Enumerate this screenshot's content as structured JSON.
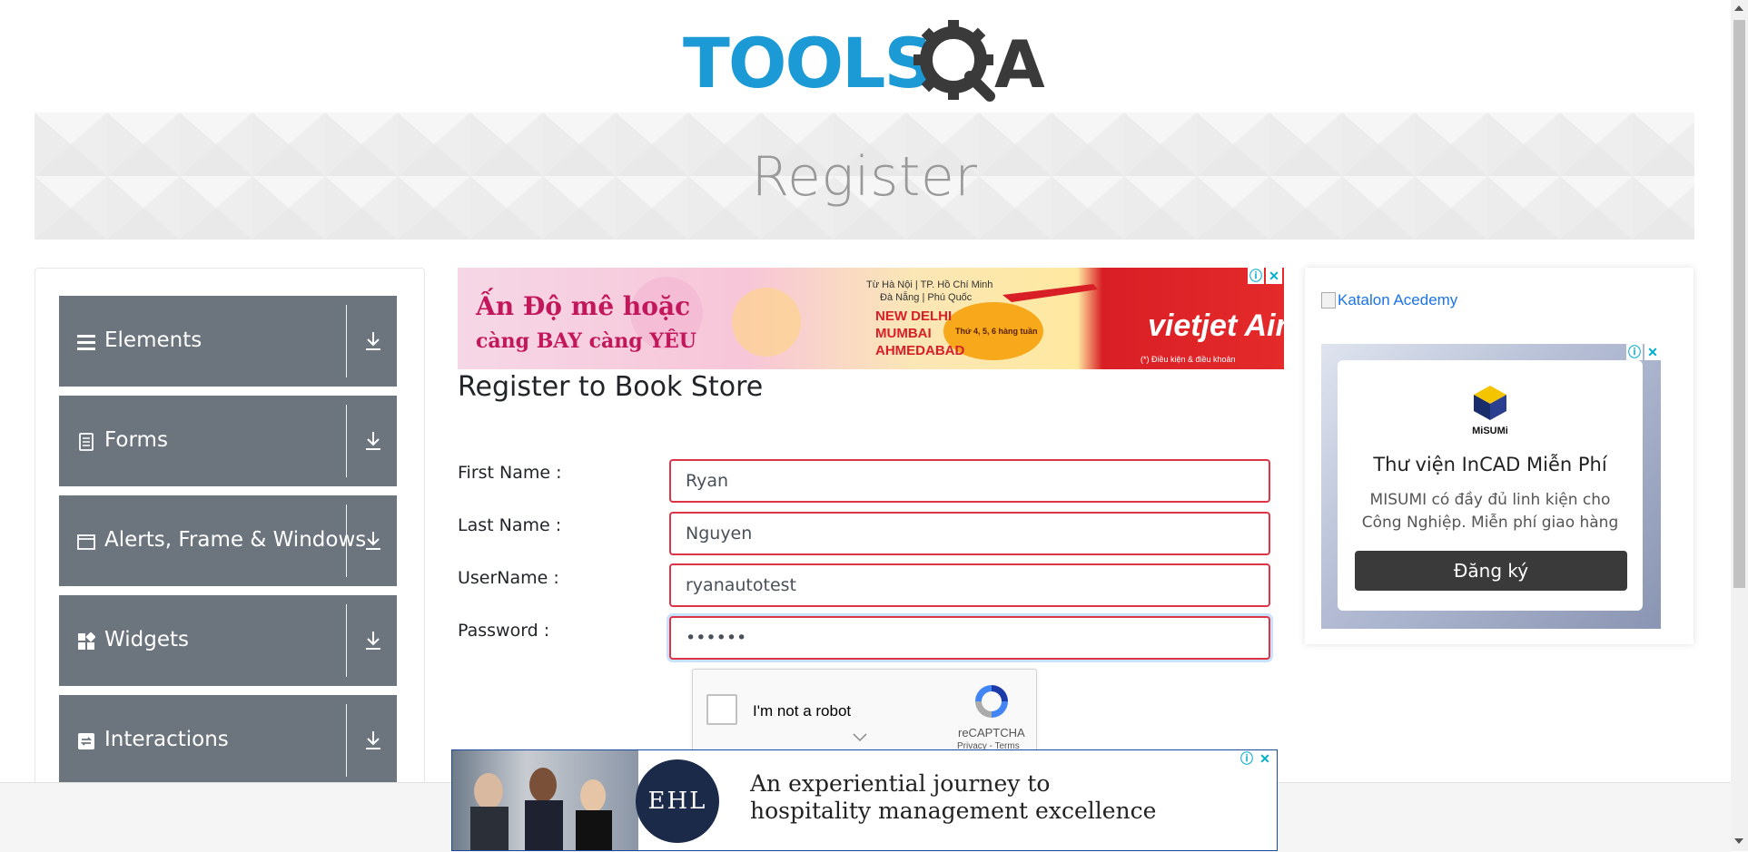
{
  "header": {
    "logo_text": "TOOLSQA"
  },
  "banner": {
    "title": "Register"
  },
  "sidebar": {
    "groups": [
      {
        "label": "Elements",
        "icon": "hamburger-icon"
      },
      {
        "label": "Forms",
        "icon": "document-icon"
      },
      {
        "label": "Alerts, Frame & Windows",
        "icon": "window-icon"
      },
      {
        "label": "Widgets",
        "icon": "widgets-icon"
      },
      {
        "label": "Interactions",
        "icon": "interactions-icon"
      }
    ]
  },
  "ad_top": {
    "headline_1": "Ấn Độ mê hoặc",
    "headline_2": "càng BAY càng YÊU",
    "routes_from": "Từ Hà Nội | TP. Hồ Chí Minh",
    "routes_from_2": "Đà Nẵng | Phú Quốc",
    "destinations": [
      "NEW DELHI",
      "MUMBAI",
      "AHMEDABAD"
    ],
    "days": "Thứ 4, 5, 6 hàng tuần",
    "brand": "vietjet Air.com",
    "disclaimer": "(*) Điều kiện & điều khoản"
  },
  "form": {
    "title": "Register to Book Store",
    "fields": [
      {
        "label": "First Name :",
        "value": "Ryan"
      },
      {
        "label": "Last Name :",
        "value": "Nguyen"
      },
      {
        "label": "UserName :",
        "value": "ryanautotest"
      },
      {
        "label": "Password :",
        "value": "••••••"
      }
    ]
  },
  "captcha": {
    "label": "I'm not a robot",
    "brand": "reCAPTCHA",
    "links": "Privacy - Terms"
  },
  "right_panel": {
    "katalon_alt": "Katalon Acedemy",
    "ad": {
      "logo_name": "MiSUMi",
      "heading": "Thư viện InCAD Miễn Phí",
      "body": "MISUMI có đầy đủ linh kiện cho Công Nghiệp. Miễn phí giao hàng",
      "button": "Đăng ký"
    }
  },
  "ad_bottom": {
    "logo": "EHL",
    "line1": "An experiential journey to",
    "line2": "hospitality management excellence"
  },
  "colors": {
    "sidebar_group_bg": "#6c757d",
    "input_error_border": "#dc3545",
    "logo_blue": "#1b9ad6",
    "logo_dark": "#3a3a3a"
  }
}
